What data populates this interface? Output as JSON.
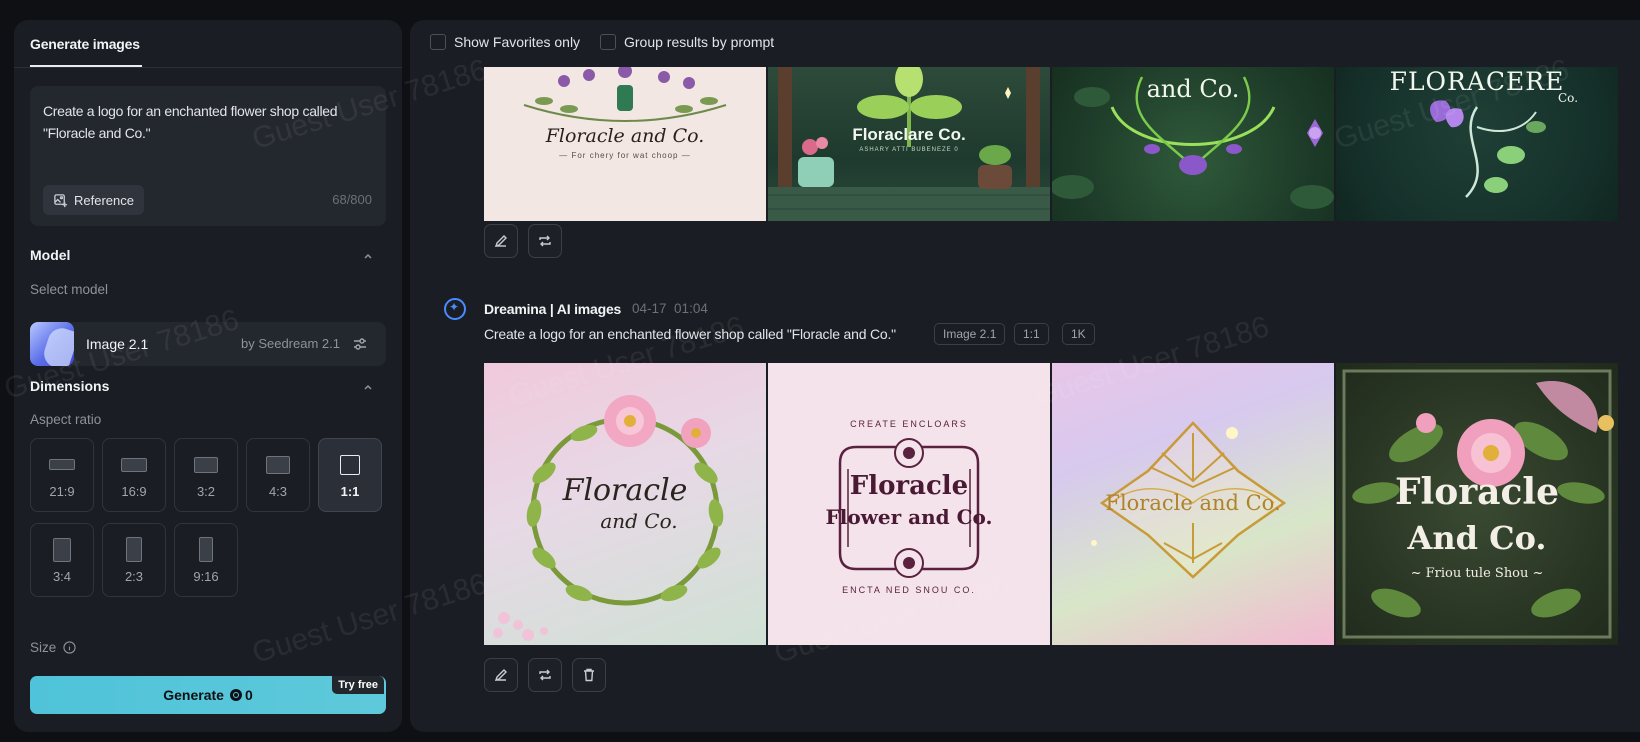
{
  "left_panel": {
    "tab_label": "Generate images",
    "prompt_text": "Create a logo for an enchanted flower shop called \"Floracle and Co.\"",
    "reference_label": "Reference",
    "char_count": "68/800",
    "model_section": "Model",
    "select_model_label": "Select model",
    "model_name": "Image 2.1",
    "model_by": "by Seedream 2.1",
    "dimensions_section": "Dimensions",
    "aspect_ratio_label": "Aspect ratio",
    "ratios": [
      "21:9",
      "16:9",
      "3:2",
      "4:3",
      "1:1",
      "3:4",
      "2:3",
      "9:16"
    ],
    "selected_ratio": "1:1",
    "size_label": "Size",
    "generate_label": "Generate",
    "generate_credits": "0",
    "try_free": "Try free"
  },
  "filters": {
    "favorites": "Show Favorites only",
    "group": "Group results by prompt"
  },
  "top_group": {
    "images": [
      {
        "title": "Floracle and Co.",
        "subtitle": "— For chery for wat choop —"
      },
      {
        "title": "Floraclare Co.",
        "subtitle": "ASHARY ATTI BUBENEZE 0"
      },
      {
        "title": "and Co.",
        "subtitle": ""
      },
      {
        "title": "FLORACERE",
        "subtitle": "Co."
      }
    ]
  },
  "bottom_group": {
    "author": "Dreamina | AI images",
    "date": "04-17",
    "time": "01:04",
    "prompt": "Create a logo for an enchanted flower shop called \"Floracle and Co.\"",
    "tags": [
      "Image 2.1",
      "1:1",
      "1K"
    ],
    "images": [
      {
        "line1": "Floracle",
        "line2": "and Co."
      },
      {
        "arc_top": "CREATE ENCLOARS",
        "line1": "Floracle",
        "line2": "Flower and Co.",
        "arc_bottom": "ENCTA NED SNOU CO."
      },
      {
        "line1": "Floracle and Co."
      },
      {
        "line1": "Floracle",
        "line2": "And Co.",
        "line3": "~ Friou tule Shou ~"
      }
    ]
  },
  "watermark": "Guest User 78186",
  "colors": {
    "accent": "#5ec9da",
    "panel": "#1a1d23",
    "background": "#0e1014",
    "brand_blue": "#4a8cff"
  }
}
